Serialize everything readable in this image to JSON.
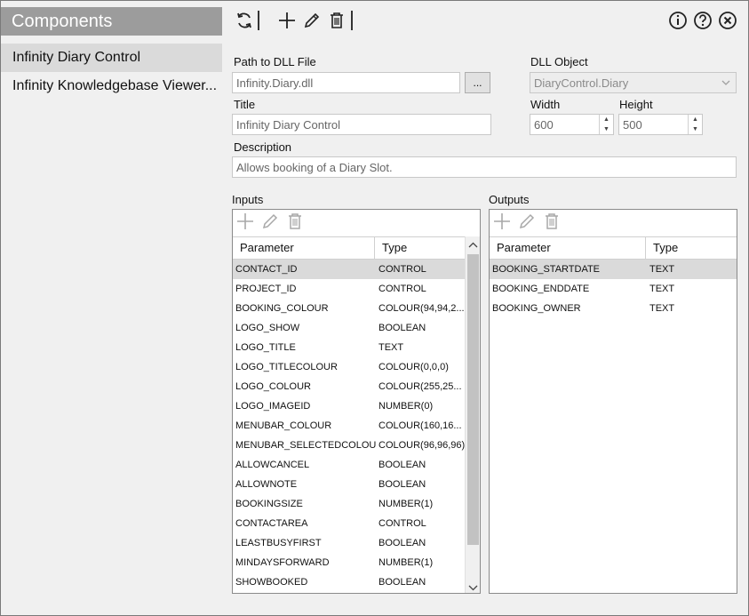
{
  "sidebar": {
    "title": "Components",
    "items": [
      {
        "label": "Infinity Diary Control",
        "selected": true
      },
      {
        "label": "Infinity Knowledgebase Viewer..."
      }
    ]
  },
  "toolbar": {
    "icons": [
      "refresh-icon",
      "add-icon",
      "edit-icon",
      "delete-icon",
      "info-icon",
      "help-icon",
      "close-icon"
    ]
  },
  "form": {
    "dll_path_label": "Path to DLL File",
    "dll_path_value": "Infinity.Diary.dll",
    "browse_label": "...",
    "dll_object_label": "DLL Object",
    "dll_object_value": "DiaryControl.Diary",
    "title_label": "Title",
    "title_value": "Infinity Diary Control",
    "width_label": "Width",
    "width_value": "600",
    "height_label": "Height",
    "height_value": "500",
    "description_label": "Description",
    "description_value": "Allows booking of a Diary Slot."
  },
  "inputs": {
    "label": "Inputs",
    "columns": [
      "Parameter",
      "Type"
    ],
    "rows": [
      [
        "CONTACT_ID",
        "CONTROL"
      ],
      [
        "PROJECT_ID",
        "CONTROL"
      ],
      [
        "BOOKING_COLOUR",
        "COLOUR(94,94,2..."
      ],
      [
        "LOGO_SHOW",
        "BOOLEAN"
      ],
      [
        "LOGO_TITLE",
        "TEXT"
      ],
      [
        "LOGO_TITLECOLOUR",
        "COLOUR(0,0,0)"
      ],
      [
        "LOGO_COLOUR",
        "COLOUR(255,25..."
      ],
      [
        "LOGO_IMAGEID",
        "NUMBER(0)"
      ],
      [
        "MENUBAR_COLOUR",
        "COLOUR(160,16..."
      ],
      [
        "MENUBAR_SELECTEDCOLOUR",
        "COLOUR(96,96,96)"
      ],
      [
        "ALLOWCANCEL",
        "BOOLEAN"
      ],
      [
        "ALLOWNOTE",
        "BOOLEAN"
      ],
      [
        "BOOKINGSIZE",
        "NUMBER(1)"
      ],
      [
        "CONTACTAREA",
        "CONTROL"
      ],
      [
        "LEASTBUSYFIRST",
        "BOOLEAN"
      ],
      [
        "MINDAYSFORWARD",
        "NUMBER(1)"
      ],
      [
        "SHOWBOOKED",
        "BOOLEAN"
      ]
    ]
  },
  "outputs": {
    "label": "Outputs",
    "columns": [
      "Parameter",
      "Type"
    ],
    "rows": [
      [
        "BOOKING_STARTDATE",
        "TEXT"
      ],
      [
        "BOOKING_ENDDATE",
        "TEXT"
      ],
      [
        "BOOKING_OWNER",
        "TEXT"
      ]
    ]
  },
  "colors": {
    "sidebar_header": "#9c9c9c",
    "selected_row": "#dadada",
    "panel_bg": "#f0f0f0"
  }
}
